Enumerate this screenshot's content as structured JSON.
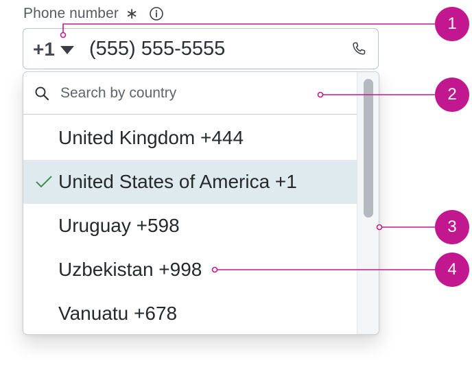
{
  "field": {
    "label": "Phone number",
    "required_mark": "∗",
    "info_icon": "info-circle-icon",
    "country_code": "+1",
    "value": "(555) 555-5555",
    "trailing_icon": "phone-icon"
  },
  "dropdown": {
    "search_placeholder": "Search by country",
    "search_icon": "search-icon",
    "options": [
      {
        "label": "United Kingdom +444",
        "selected": false
      },
      {
        "label": "United States of America +1",
        "selected": true
      },
      {
        "label": "Uruguay +598",
        "selected": false
      },
      {
        "label": "Uzbekistan +998",
        "selected": false
      },
      {
        "label": "Vanuatu +678",
        "selected": false
      }
    ],
    "selected_icon": "checkmark-icon"
  },
  "callouts": [
    "1",
    "2",
    "3",
    "4"
  ],
  "colors": {
    "callout": "#c2188f",
    "selected_row": "#dfeaee",
    "check": "#3f8f4f",
    "border": "#b9c0c6"
  }
}
